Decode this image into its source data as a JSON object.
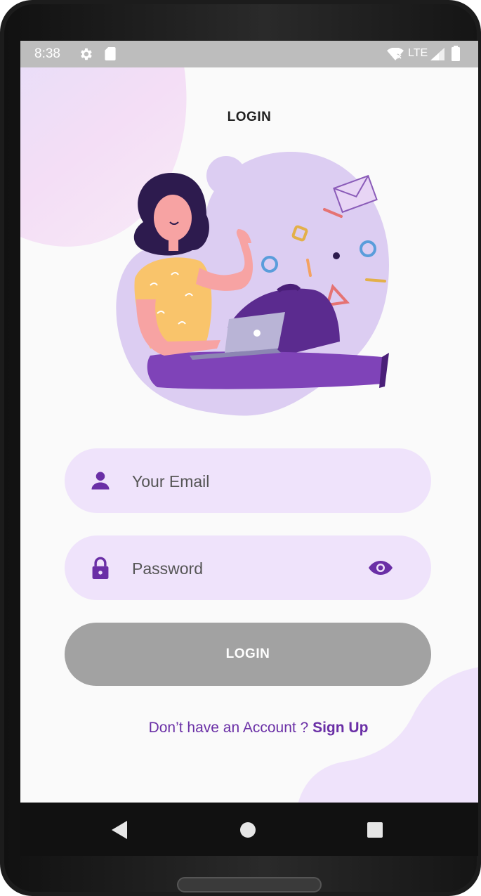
{
  "status_bar": {
    "time": "8:38",
    "network": "LTE",
    "icons": [
      "gear-icon",
      "sd-card-icon",
      "wifi-icon",
      "signal-icon",
      "battery-icon"
    ]
  },
  "header": {
    "title": "LOGIN"
  },
  "illustration": {
    "icon": "woman-with-laptop-illustration"
  },
  "form": {
    "email_placeholder": "Your Email",
    "email_value": "",
    "email_icon": "person-icon",
    "password_placeholder": "Password",
    "password_value": "",
    "password_icon": "lock-icon",
    "password_toggle_icon": "eye-icon",
    "login_label": "LOGIN"
  },
  "footer": {
    "prompt": "Don’t have an Account ? ",
    "link": "Sign Up"
  },
  "nav_bar": {
    "icons": [
      "back-icon",
      "home-icon",
      "recents-icon"
    ]
  },
  "colors": {
    "accent": "#6a2fa6",
    "field_bg": "#efe3fb",
    "button_disabled": "#a2a2a2",
    "illustration_blob": "#dccdf2"
  }
}
